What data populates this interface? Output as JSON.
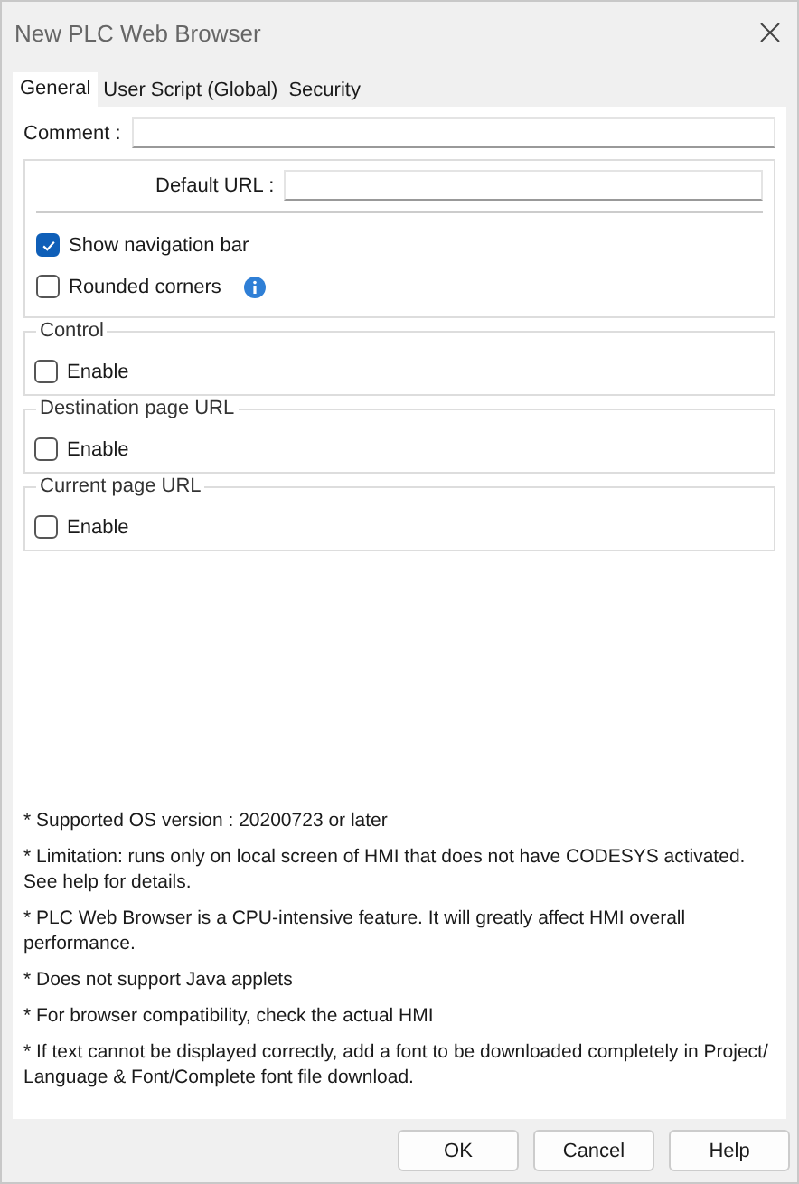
{
  "window": {
    "title": "New PLC Web Browser"
  },
  "tabs": [
    {
      "label": "General",
      "selected": true
    },
    {
      "label": "User Script (Global)",
      "selected": false
    },
    {
      "label": "Security",
      "selected": false
    }
  ],
  "comment": {
    "label": "Comment :"
  },
  "default_url": {
    "label": "Default URL :"
  },
  "options": [
    {
      "label": "Show navigation bar",
      "checked": true,
      "info": false
    },
    {
      "label": "Rounded corners",
      "checked": false,
      "info": true
    }
  ],
  "groups": [
    {
      "title": "Control",
      "enable": {
        "label": "Enable",
        "checked": false
      }
    },
    {
      "title": "Destination page URL",
      "enable": {
        "label": "Enable",
        "checked": false
      }
    },
    {
      "title": "Current page URL",
      "enable": {
        "label": "Enable",
        "checked": false
      }
    }
  ],
  "notes": [
    "* Supported OS version : 20200723 or later",
    "* Limitation: runs only on local screen of HMI that does not have CODESYS activated. See help for details.",
    "* PLC Web Browser is a CPU-intensive feature. It will greatly affect HMI overall performance.",
    "* Does not support Java applets",
    "* For browser compatibility, check the actual HMI",
    "* If text cannot be displayed correctly, add a font to be downloaded completely in Project/ Language & Font/Complete font file download."
  ],
  "buttons": [
    {
      "label": "OK"
    },
    {
      "label": "Cancel"
    },
    {
      "label": "Help"
    }
  ]
}
